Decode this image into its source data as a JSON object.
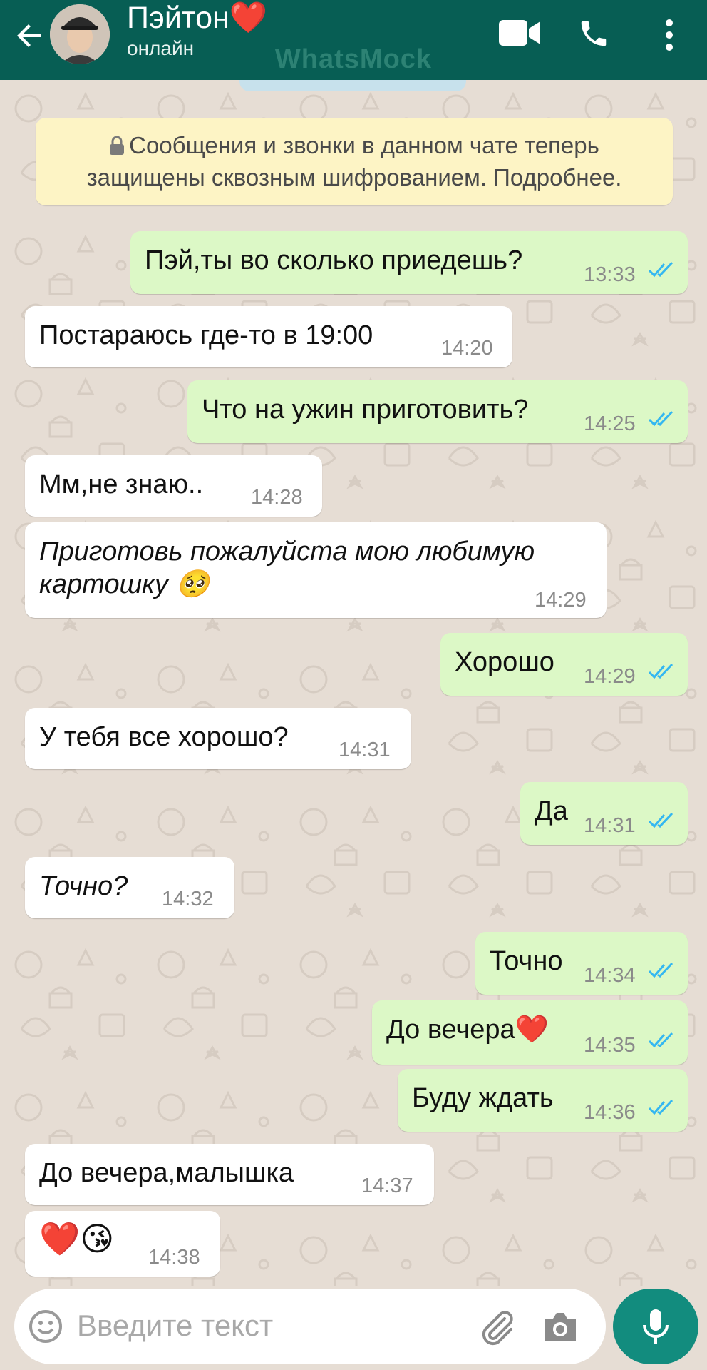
{
  "header": {
    "contact_name": "Пэйтон❤️",
    "status": "онлайн",
    "watermark": "WhatsMock",
    "icons": [
      "back-arrow-icon",
      "video-call-icon",
      "phone-call-icon",
      "more-vert-icon"
    ],
    "colors": {
      "bar": "#075e54",
      "incoming": "#ffffff",
      "outgoing": "#dcf8c6",
      "ticks": "#34b7f1"
    }
  },
  "notice": {
    "line1": "Сообщения и звонки в данном чате теперь",
    "line2": "защищены сквозным шифрованием. Подробнее."
  },
  "messages": [
    {
      "dir": "out",
      "text": "Пэй,ты во сколько приедешь?",
      "time": "13:33",
      "read": true
    },
    {
      "dir": "in",
      "text": "Постараюсь где-то в 19:00",
      "time": "14:20"
    },
    {
      "dir": "out",
      "text": "Что на ужин приготовить?",
      "time": "14:25",
      "read": true
    },
    {
      "dir": "in",
      "text": "Мм,не знаю..",
      "time": "14:28"
    },
    {
      "dir": "in",
      "text_line1": "Приготовь пожалуйста мою любимую",
      "text_line2": "картошку 🥺",
      "time": "14:29",
      "italic": true
    },
    {
      "dir": "out",
      "text": "Хорошо",
      "time": "14:29",
      "read": true
    },
    {
      "dir": "in",
      "text": "У тебя все хорошо?",
      "time": "14:31"
    },
    {
      "dir": "out",
      "text": "Да",
      "time": "14:31",
      "read": true
    },
    {
      "dir": "in",
      "text": "Точно?",
      "time": "14:32",
      "italic": true
    },
    {
      "dir": "out",
      "text": "Точно",
      "time": "14:34",
      "read": true
    },
    {
      "dir": "out",
      "text": "До вечера❤️",
      "time": "14:35",
      "read": true
    },
    {
      "dir": "out",
      "text": "Буду ждать",
      "time": "14:36",
      "read": true
    },
    {
      "dir": "in",
      "text": "До вечера,малышка",
      "time": "14:37"
    },
    {
      "dir": "in",
      "text": "❤️😘",
      "time": "14:38"
    }
  ],
  "input": {
    "placeholder": "Введите текст",
    "icons": [
      "emoji-icon",
      "attach-clip-icon",
      "camera-icon",
      "microphone-icon"
    ]
  }
}
